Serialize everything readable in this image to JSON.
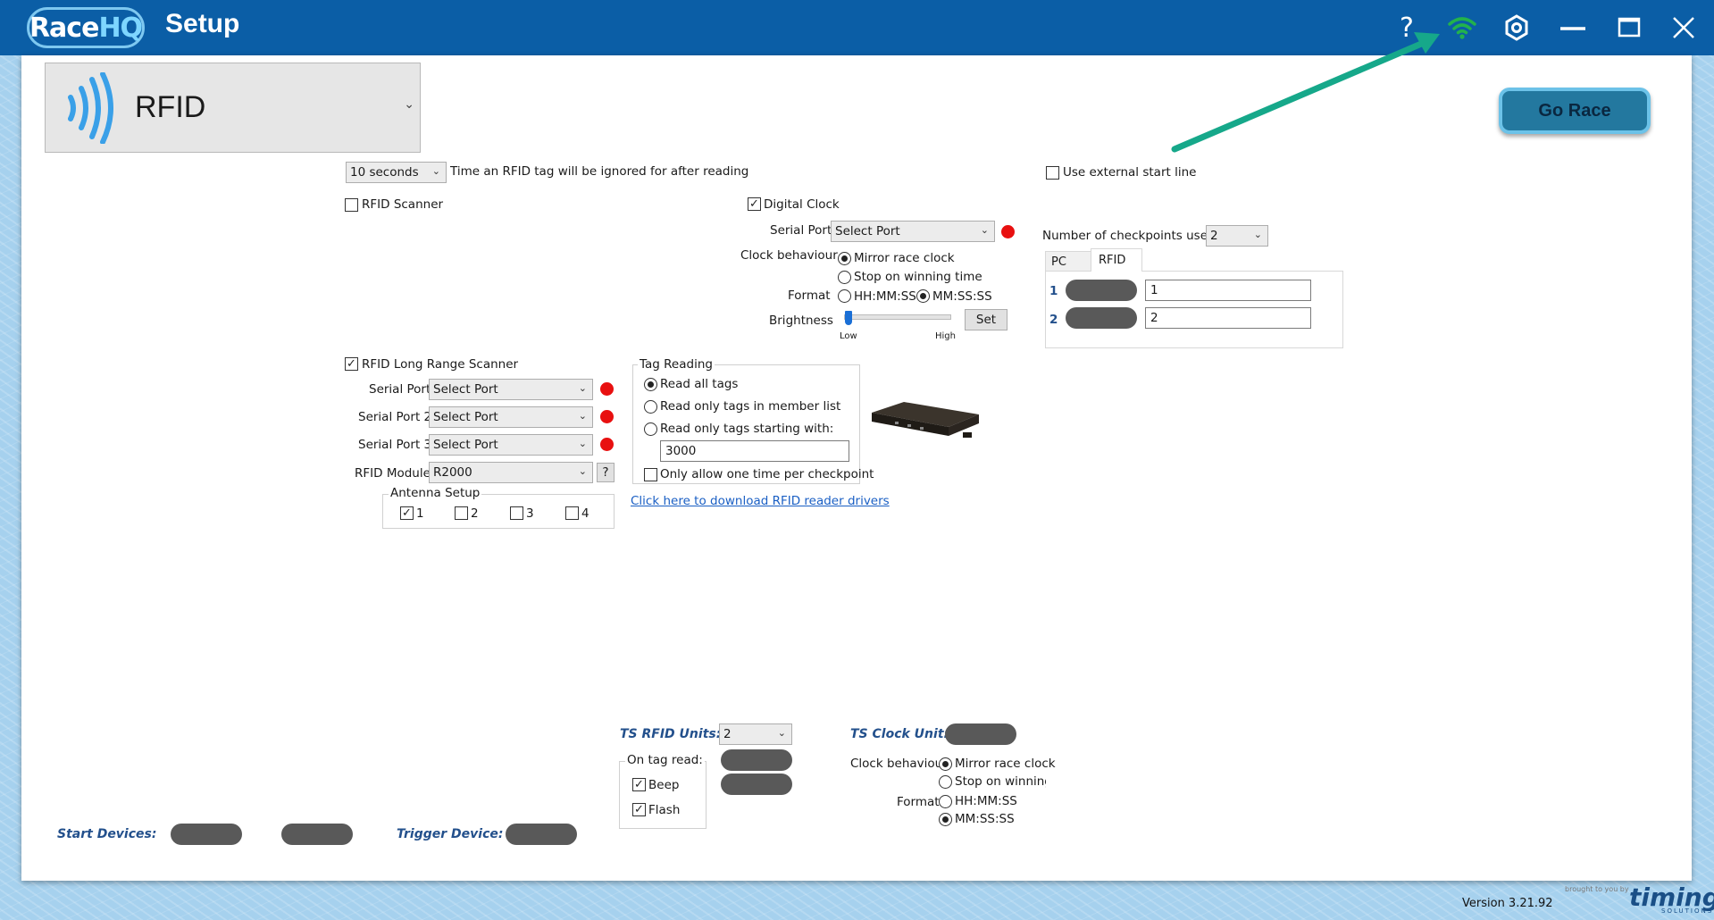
{
  "app": {
    "logo_text_1": "Race",
    "logo_text_2": "HQ",
    "title": "Setup"
  },
  "titlebar_icons": {
    "help": "?",
    "wifi": "wifi-icon",
    "settings": "gear-icon",
    "minimize": "minimize-icon",
    "maximize": "maximize-icon",
    "close": "close-icon"
  },
  "section": {
    "label": "RFID",
    "icon": "rfid-waves-icon"
  },
  "go_race": "Go Race",
  "ignore_time": {
    "value": "10 seconds",
    "label": "Time an RFID tag will be ignored for after reading"
  },
  "external_start": {
    "label": "Use external start line",
    "checked": false
  },
  "rfid_scanner": {
    "label": "RFID Scanner",
    "checked": false
  },
  "digital_clock": {
    "label": "Digital Clock",
    "checked": true,
    "serial_port_label": "Serial Port",
    "serial_port_value": "Select Port",
    "clock_behaviour_label": "Clock behaviour",
    "behaviour_options": [
      "Mirror race clock",
      "Stop on winning time"
    ],
    "format_label": "Format",
    "format_options": [
      "HH:MM:SS",
      "MM:SS:SS"
    ],
    "brightness_label": "Brightness",
    "brightness_low": "Low",
    "brightness_high": "High",
    "set_button": "Set"
  },
  "checkpoints": {
    "label": "Number of checkpoints used:",
    "value": "2",
    "tabs": [
      "PC",
      "RFID"
    ],
    "rows": [
      {
        "num": "1",
        "value": "1"
      },
      {
        "num": "2",
        "value": "2"
      }
    ]
  },
  "long_range": {
    "label": "RFID Long Range Scanner",
    "checked": true,
    "ports": [
      {
        "label": "Serial Port",
        "value": "Select Port"
      },
      {
        "label": "Serial Port 2",
        "value": "Select Port"
      },
      {
        "label": "Serial Port 3",
        "value": "Select Port"
      }
    ],
    "module_label": "RFID Module",
    "module_value": "R2000",
    "help_button": "?",
    "antenna_title": "Antenna Setup",
    "antennas": [
      "1",
      "2",
      "3",
      "4"
    ]
  },
  "tag_reading": {
    "title": "Tag Reading",
    "options": [
      "Read all tags",
      "Read only tags in member list",
      "Read only tags starting with:"
    ],
    "prefix_value": "3000",
    "once_label": "Only allow one time per checkpoint"
  },
  "download_link": "Click here to download RFID reader drivers",
  "ts_rfid": {
    "label": "TS RFID Units:",
    "value": "2",
    "on_tag_read": "On tag read:",
    "beep": "Beep",
    "flash": "Flash"
  },
  "ts_clock": {
    "label": "TS Clock Unit:",
    "behaviour_label": "Clock behaviour",
    "behaviour_options": [
      "Mirror race clock",
      "Stop on winning t"
    ],
    "format_label": "Format",
    "format_options": [
      "HH:MM:SS",
      "MM:SS:SS"
    ]
  },
  "start_devices": "Start Devices:",
  "trigger_device": "Trigger Device:",
  "version": "Version 3.21.92",
  "footer_brand": "timing",
  "footer_brand_small": "brought to you by",
  "footer_brand_sub": "SOLUTIONS",
  "colors": {
    "titlebar": "#0b5ea6",
    "accent": "#23789f",
    "status_red": "#e81010",
    "wifi_green": "#22b24c",
    "arrow": "#16a88a"
  }
}
